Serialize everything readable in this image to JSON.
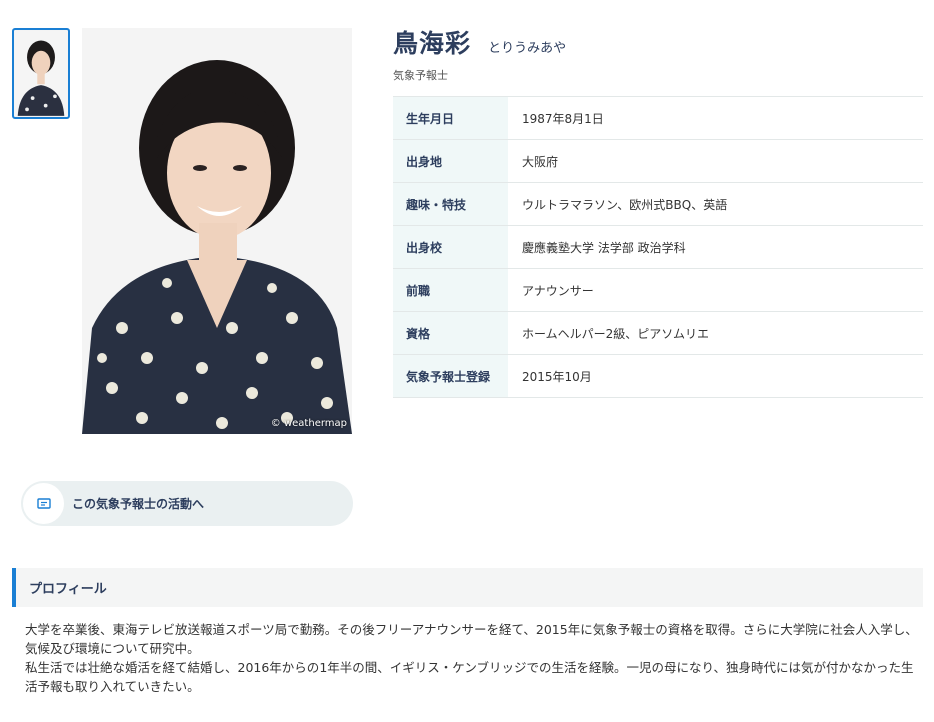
{
  "person": {
    "name": "鳥海彩",
    "kana": "とりうみあや",
    "role": "気象予報士",
    "photo_credit": "© weathermap"
  },
  "info_rows": [
    {
      "label": "生年月日",
      "value": "1987年8月1日"
    },
    {
      "label": "出身地",
      "value": "大阪府"
    },
    {
      "label": "趣味・特技",
      "value": "ウルトラマラソン、欧州式BBQ、英語"
    },
    {
      "label": "出身校",
      "value": "慶應義塾大学 法学部 政治学科"
    },
    {
      "label": "前職",
      "value": "アナウンサー"
    },
    {
      "label": "資格",
      "value": "ホームヘルパー2級、ピアソムリエ"
    },
    {
      "label": "気象予報士登録",
      "value": "2015年10月"
    }
  ],
  "activity_button": {
    "label": "この気象予報士の活動へ",
    "icon": "document-icon"
  },
  "profile": {
    "heading": "プロフィール",
    "paragraphs": [
      "大学を卒業後、東海テレビ放送報道スポーツ局で勤務。その後フリーアナウンサーを経て、2015年に気象予報士の資格を取得。さらに大学院に社会人入学し、気候及び環境について研究中。",
      "私生活では壮絶な婚活を経て結婚し、2016年からの1年半の間、イギリス・ケンブリッジでの生活を経験。一児の母になり、独身時代には気が付かなかった生活予報も取り入れていきたい。"
    ]
  },
  "colors": {
    "accent": "#1a7fd4",
    "heading": "#2d3e5e",
    "row_label_bg": "#f0f8f8"
  }
}
